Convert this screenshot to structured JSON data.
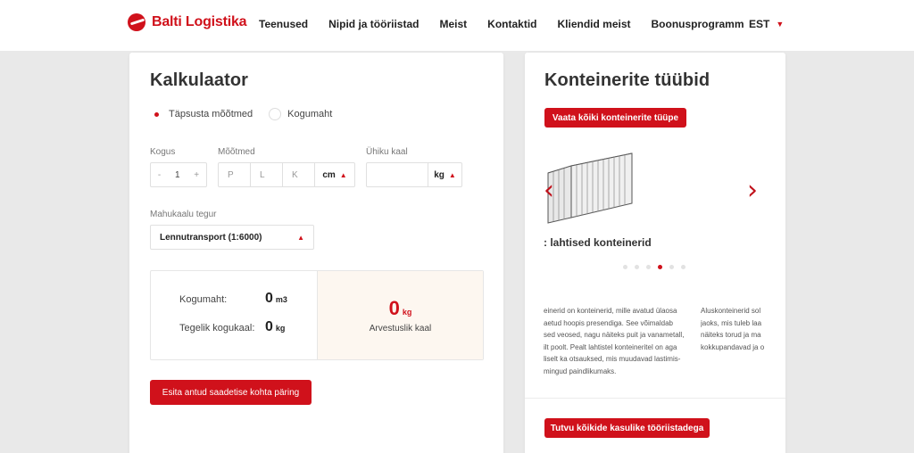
{
  "header": {
    "logo_text": "Balti Logistika",
    "nav": [
      "Teenused",
      "Nipid ja tööriistad",
      "Meist",
      "Kontaktid",
      "Kliendid meist",
      "Boonusprogramm"
    ],
    "language": "EST"
  },
  "calculator": {
    "title": "Kalkulaator",
    "radio_options": [
      {
        "label": "Täpsusta mõõtmed",
        "selected": true
      },
      {
        "label": "Kogumaht",
        "selected": false
      }
    ],
    "quantity_label": "Kogus",
    "quantity_value": "1",
    "quantity_minus": "-",
    "quantity_plus": "+",
    "dimensions_label": "Mõõtmed",
    "dim_placeholders": [
      "P",
      "L",
      "K"
    ],
    "dim_unit": "cm",
    "unit_weight_label": "Ühiku kaal",
    "weight_unit": "kg",
    "volume_factor_label": "Mahukaalu tegur",
    "volume_factor_value": "Lennutransport (1:6000)",
    "total_volume_label": "Kogumaht:",
    "total_volume_value": "0",
    "total_volume_unit": "m3",
    "actual_weight_label": "Tegelik kogukaal:",
    "actual_weight_value": "0",
    "actual_weight_unit": "kg",
    "chargeable_value": "0",
    "chargeable_unit": "kg",
    "chargeable_label": "Arvestuslik kaal",
    "submit_label": "Esita antud saadetise kohta päring"
  },
  "container_types": {
    "title": "Konteinerite tüübid",
    "view_all_label": "Vaata kõiki konteinerite tüüpe",
    "slide_title": ": lahtised konteinerid",
    "slide_count": 6,
    "active_slide": 4,
    "desc_col1": [
      "einerid on konteinerid, mille avatud ülaosa",
      "aetud hoopis presendiga. See võimaldab",
      "sed veosed, nagu näiteks puit ja vanametall,",
      "ilt poolt. Pealt lahtistel konteineritel on aga",
      "liselt ka otsauksed, mis muudavad lastimis-",
      "mingud paindlikumaks."
    ],
    "desc_col2": [
      "Aluskonteinerid sol",
      "jaoks, mis tuleb laa",
      "näiteks torud ja ma",
      "kokkupandavad ja o"
    ],
    "tools_label": "Tutvu kõikide kasulike tööriistadega",
    "colors": {
      "accent": "#d0111b"
    }
  }
}
